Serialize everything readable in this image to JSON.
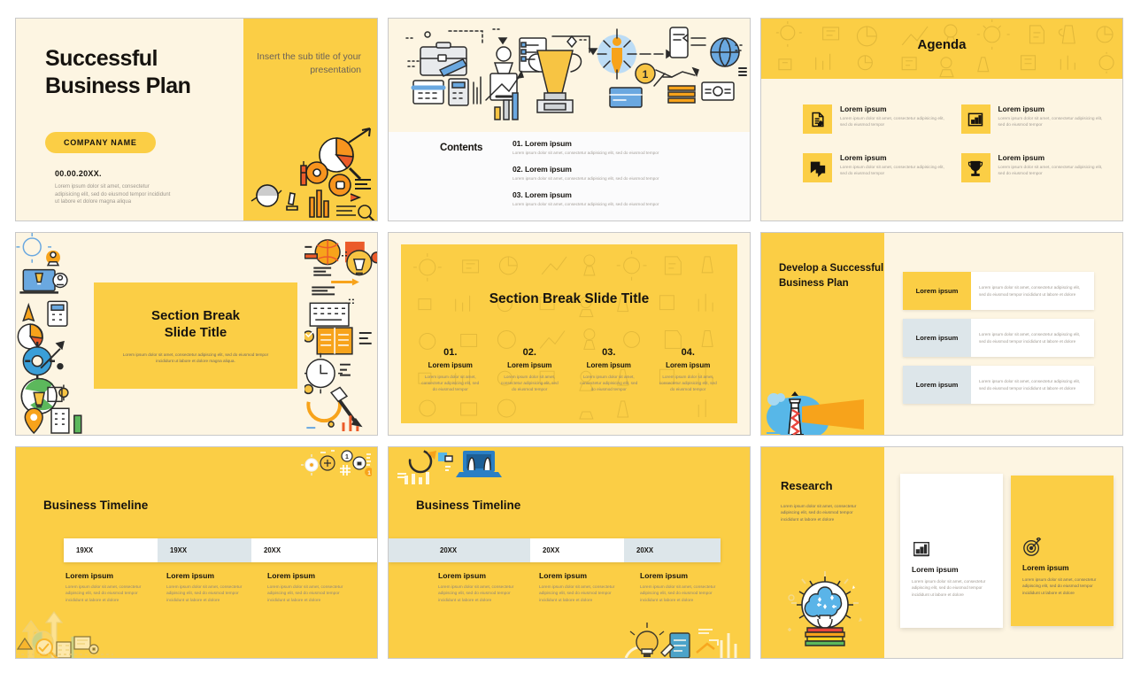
{
  "theme": {
    "yellow": "#FBCE45",
    "cream": "#FDF5E2",
    "ink": "#16130f",
    "grey_blue": "#dde6ea",
    "white": "#ffffff"
  },
  "slides": [
    {
      "id": "title-slide",
      "title_line1": "Successful",
      "title_line2": "Business Plan",
      "company_pill": "COMPANY NAME",
      "date": "00.00.20XX.",
      "body": "Lorem ipsum dolor sit amet, consectetur adipisicing elit, sed do eiusmod tempor incididunt ut labore et dolore magna aliqua",
      "subtitle": "Insert the sub title of your presentation",
      "art": "business-icons-collage"
    },
    {
      "id": "contents-slide",
      "heading": "Contents",
      "art": "business-flat-icons-banner",
      "items": [
        {
          "number": "01.",
          "title": "Lorem ipsum",
          "body": "Lorem ipsum dolor sit amet, consectetur adipisicing elit, sed do eiusmod tempor"
        },
        {
          "number": "02.",
          "title": "Lorem ipsum",
          "body": "Lorem ipsum dolor sit amet, consectetur adipisicing elit, sed do eiusmod tempor"
        },
        {
          "number": "03.",
          "title": "Lorem ipsum",
          "body": "Lorem ipsum dolor sit amet, consectetur adipisicing elit, sed do eiusmod tempor"
        }
      ]
    },
    {
      "id": "agenda-slide",
      "heading": "Agenda",
      "items": [
        {
          "icon": "document-edit-icon",
          "title": "Lorem ipsum",
          "body": "Lorem ipsum dolor sit amet, consectetur adipisicing elit, sed do eiusmod tempor"
        },
        {
          "icon": "bar-chart-icon",
          "title": "Lorem ipsum",
          "body": "Lorem ipsum dolor sit amet, consectetur adipisicing elit, sed do eiusmod tempor"
        },
        {
          "icon": "chat-bubbles-icon",
          "title": "Lorem ipsum",
          "body": "Lorem ipsum dolor sit amet, consectetur adipisicing elit, sed do eiusmod tempor"
        },
        {
          "icon": "trophy-icon",
          "title": "Lorem ipsum",
          "body": "Lorem ipsum dolor sit amet, consectetur adipisicing elit, sed do eiusmod tempor"
        }
      ]
    },
    {
      "id": "section-break-boxed-slide",
      "title_line1": "Section Break",
      "title_line2": "Slide Title",
      "body": "Lorem ipsum dolor sit amet, consectetur adipiscing elit, sed do eiusmod tempor incididunt ut labore et dolore magna aliqua.",
      "art": "colorful-business-icons-border"
    },
    {
      "id": "section-break-four-items-slide",
      "title": "Section Break Slide Title",
      "items": [
        {
          "number": "01.",
          "title": "Lorem ipsum",
          "body": "Lorem ipsum dolor sit amet, consectetur adipisicing elit, sed do eiusmod tempor"
        },
        {
          "number": "02.",
          "title": "Lorem ipsum",
          "body": "Lorem ipsum dolor sit amet, consectetur adipisicing elit, sed do eiusmod tempor"
        },
        {
          "number": "03.",
          "title": "Lorem ipsum",
          "body": "Lorem ipsum dolor sit amet, consectetur adipisicing elit, sed do eiusmod tempor"
        },
        {
          "number": "04.",
          "title": "Lorem ipsum",
          "body": "Lorem ipsum dolor sit amet, consectetur adipisicing elit, sed do eiusmod tempor"
        }
      ]
    },
    {
      "id": "develop-plan-slide",
      "title": "Develop a Successful Business Plan",
      "art": "lighthouse-icon",
      "rows": [
        {
          "label": "Lorem ipsum",
          "body": "Lorem ipsum dolor sit amet, consectetur adipiscing elit, sed do eiusmod tempor incididunt ut labore et dolore",
          "accent": "yellow"
        },
        {
          "label": "Lorem ipsum",
          "body": "Lorem ipsum dolor sit amet, consectetur adipiscing elit, sed do eiusmod tempor incididunt ut labore et dolore",
          "accent": "grey"
        },
        {
          "label": "Lorem ipsum",
          "body": "Lorem ipsum dolor sit amet, consectetur adipiscing elit, sed do eiusmod tempor incididunt ut labore et dolore",
          "accent": "grey"
        }
      ]
    },
    {
      "id": "business-timeline-a-slide",
      "title": "Business Timeline",
      "art_top": "gears-and-ladder-icons",
      "art_bottom": "growth-arrows-icons",
      "years": [
        {
          "label": "19XX",
          "fill": "white"
        },
        {
          "label": "19XX",
          "fill": "grey"
        },
        {
          "label": "20XX",
          "fill": "white"
        }
      ],
      "columns": [
        {
          "title": "Lorem ipsum",
          "body": "Lorem ipsum dolor sit amet, consectetur adipiscing elit, sed do eiusmod tempor incididunt ut labore et dolore"
        },
        {
          "title": "Lorem ipsum",
          "body": "Lorem ipsum dolor sit amet, consectetur adipiscing elit, sed do eiusmod tempor incididunt ut labore et dolore"
        },
        {
          "title": "Lorem ipsum",
          "body": "Lorem ipsum dolor sit amet, consectetur adipiscing elit, sed do eiusmod tempor incididunt ut labore et dolore"
        }
      ]
    },
    {
      "id": "business-timeline-b-slide",
      "title": "Business Timeline",
      "art_top": "laptop-hands-icons",
      "art_bottom": "lightbulb-document-icons",
      "years": [
        {
          "label": "20XX",
          "fill": "grey"
        },
        {
          "label": "20XX",
          "fill": "white"
        },
        {
          "label": "20XX",
          "fill": "grey"
        }
      ],
      "columns": [
        {
          "title": "Lorem ipsum",
          "body": "Lorem ipsum dolor sit amet, consectetur adipiscing elit, sed do eiusmod tempor incididunt ut labore et dolore"
        },
        {
          "title": "Lorem ipsum",
          "body": "Lorem ipsum dolor sit amet, consectetur adipiscing elit, sed do eiusmod tempor incididunt ut labore et dolore"
        },
        {
          "title": "Lorem ipsum",
          "body": "Lorem ipsum dolor sit amet, consectetur adipiscing elit, sed do eiusmod tempor incididunt ut labore et dolore"
        }
      ]
    },
    {
      "id": "research-slide",
      "title": "Research",
      "body": "Lorem ipsum dolor sit amet, consectetur adipiscing elit, sed do eiusmod tempor incididunt ut labore et dolore",
      "art": "brain-lightbulb-on-books",
      "cards": [
        {
          "icon": "bar-chart-icon",
          "title": "Lorem ipsum",
          "body": "Lorem ipsum dolor sit amet, consectetur adipiscing elit, sed do eiusmod tempor incididunt ut labore et dolore"
        },
        {
          "icon": "target-icon",
          "title": "Lorem ipsum",
          "body": "Lorem ipsum dolor sit amet, consectetur adipiscing elit, sed do eiusmod tempor incididunt ut labore et dolore"
        }
      ]
    }
  ]
}
